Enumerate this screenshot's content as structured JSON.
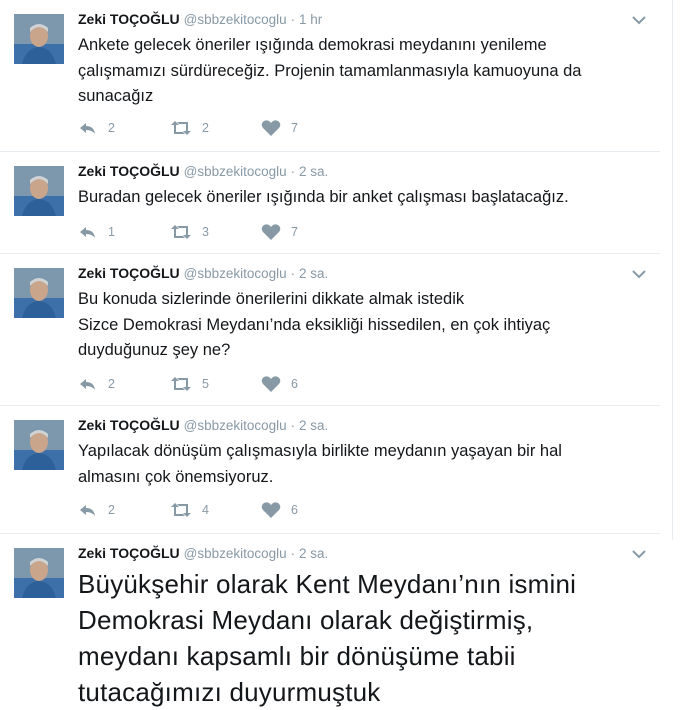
{
  "tweets": [
    {
      "name": "Zeki TOÇOĞLU",
      "handle": "@sbbzekitocoglu",
      "dot": "·",
      "time": "1 hr",
      "lines": [
        "Ankete gelecek öneriler ışığında demokrasi meydanını yenileme",
        "çalışmamızı sürdüreceğiz. Projenin tamamlanmasıyla kamuoyuna da",
        "sunacağız"
      ],
      "replies": "2",
      "retweets": "2",
      "likes": "7"
    },
    {
      "name": "Zeki TOÇOĞLU",
      "handle": "@sbbzekitocoglu",
      "dot": "·",
      "time": "2 sa.",
      "lines": [
        "Buradan gelecek öneriler ışığında bir anket çalışması başlatacağız."
      ],
      "replies": "1",
      "retweets": "3",
      "likes": "7"
    },
    {
      "name": "Zeki TOÇOĞLU",
      "handle": "@sbbzekitocoglu",
      "dot": "·",
      "time": "2 sa.",
      "lines": [
        "Bu konuda sizlerinde önerilerini dikkate almak istedik",
        "Sizce Demokrasi Meydanı’nda eksikliği hissedilen, en çok ihtiyaç",
        "duyduğunuz şey ne?"
      ],
      "replies": "2",
      "retweets": "5",
      "likes": "6"
    },
    {
      "name": "Zeki TOÇOĞLU",
      "handle": "@sbbzekitocoglu",
      "dot": "·",
      "time": "2 sa.",
      "lines": [
        "Yapılacak dönüşüm çalışmasıyla birlikte meydanın yaşayan bir hal",
        "almasını çok önemsiyoruz."
      ],
      "replies": "2",
      "retweets": "4",
      "likes": "6"
    },
    {
      "name": "Zeki TOÇOĞLU",
      "handle": "@sbbzekitocoglu",
      "dot": "·",
      "time": "2 sa.",
      "lines": [
        "Büyükşehir olarak Kent Meydanı’nın ismini",
        "Demokrasi Meydanı olarak değiştirmiş,",
        "meydanı kapsamlı bir dönüşüme tabii",
        "tutacağımızı duyurmuştuk"
      ]
    }
  ],
  "icons": {
    "reply": "reply-icon",
    "retweet": "retweet-icon",
    "like": "heart-icon",
    "caret": "chevron-down-icon"
  },
  "colors": {
    "muted": "#8899a6",
    "text": "#14171a",
    "border": "#e6ecf0"
  }
}
